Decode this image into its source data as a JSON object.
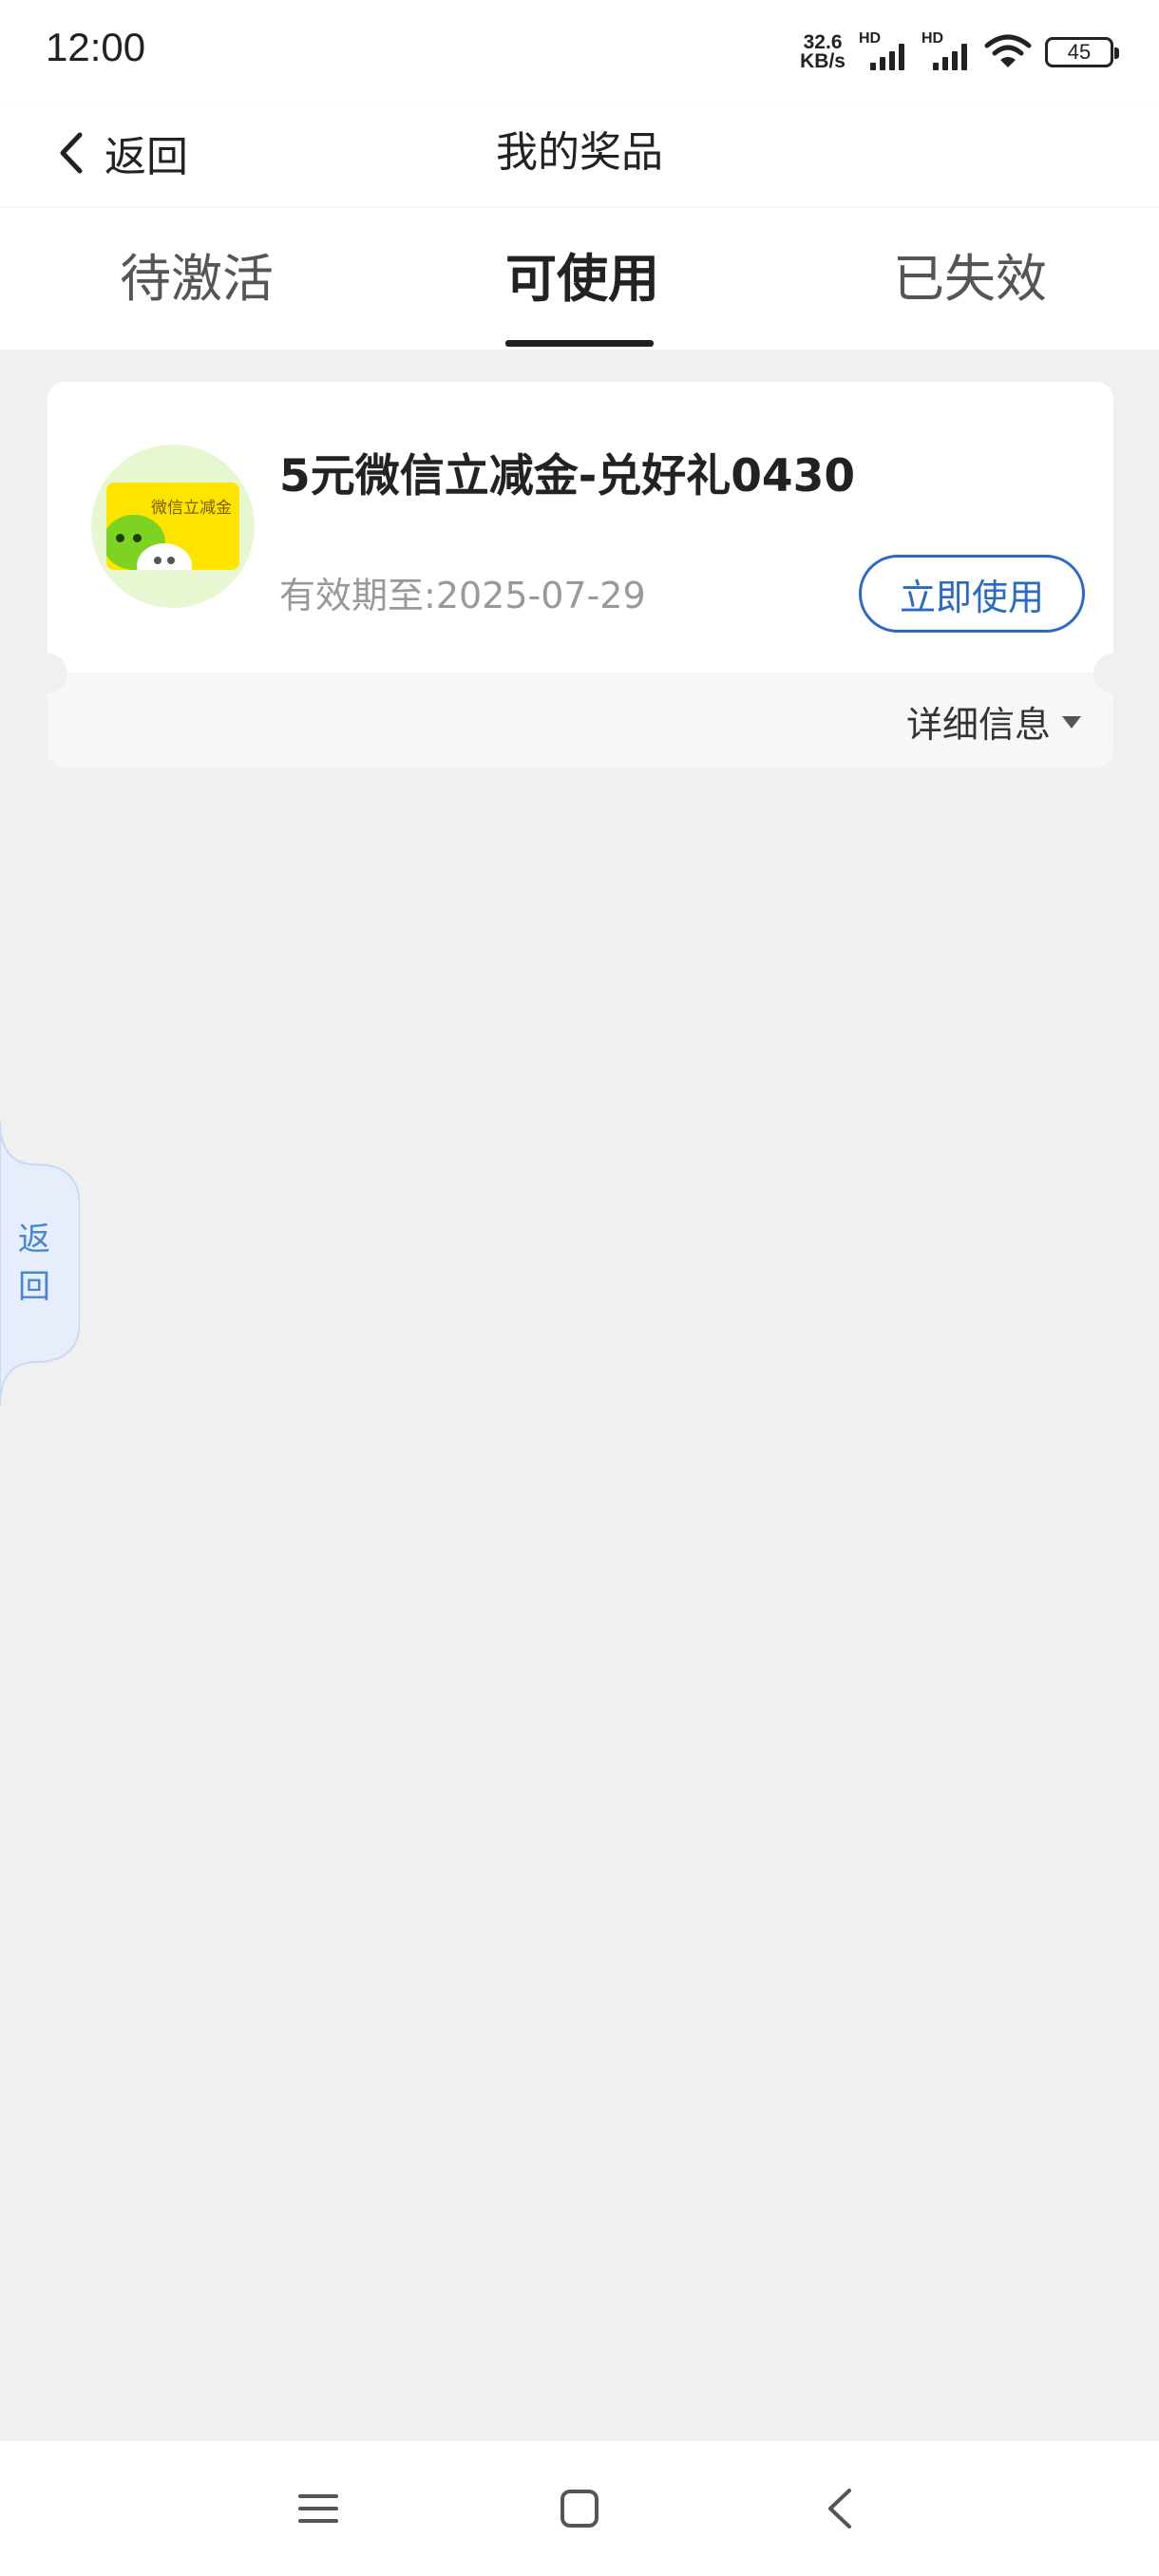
{
  "status_bar": {
    "time": "12:00",
    "net_speed_value": "32.6",
    "net_speed_unit": "KB/s",
    "sim1_label": "HD",
    "sim2_label": "HD",
    "battery": "45"
  },
  "header": {
    "back_label": "返回",
    "title": "我的奖品"
  },
  "tabs": [
    {
      "label": "待激活",
      "active": false
    },
    {
      "label": "可使用",
      "active": true
    },
    {
      "label": "已失效",
      "active": false
    }
  ],
  "prize_card": {
    "thumbnail_text": "微信立减金",
    "name": "5元微信立减金-兑好礼0430",
    "validity_label": "有效期至:",
    "validity_date": "2025-07-29",
    "use_button_label": "立即使用",
    "details_label": "详细信息"
  },
  "side_back": {
    "char1": "返",
    "char2": "回"
  },
  "nav_bar": {
    "icons": [
      "menu-icon",
      "home-icon",
      "back-icon"
    ]
  },
  "colors": {
    "accent_blue": "#2a6ac5",
    "side_tab_text": "#4a86d0",
    "page_bg": "#f0f0f0"
  }
}
